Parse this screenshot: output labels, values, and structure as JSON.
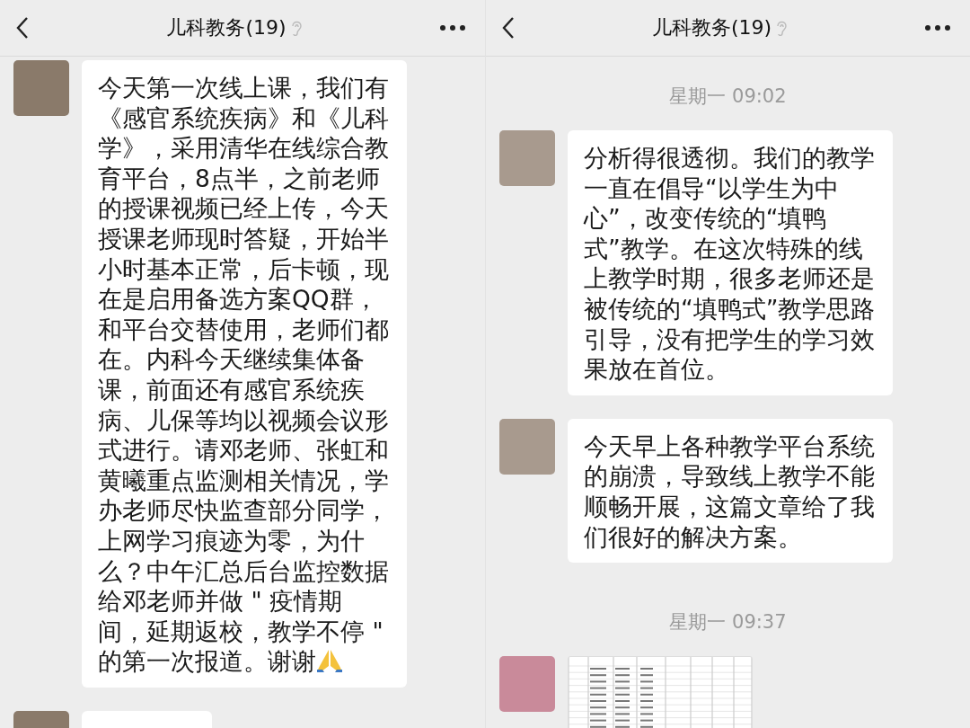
{
  "panels": [
    {
      "header": {
        "title": "儿科教务(19)"
      },
      "items": [
        {
          "kind": "message",
          "text": "今天第一次线上课，我们有《感官系统疾病》和《儿科学》，采用清华在线综合教育平台，8点半，之前老师的授课视频已经上传，今天授课老师现时答疑，开始半小时基本正常，后卡顿，现在是启用备选方案QQ群，和平台交替使用，老师们都在。内科今天继续集体备课，前面还有感官系统疾病、儿保等均以视频会议形式进行。请邓老师、张虹和黄曦重点监测相关情况，学办老师尽快监查部分同学，上网学习痕迹为零，为什么？中午汇总后台监控数据给邓老师并做 \" 疫情期间，延期返校，教学不停 \" 的第一次报道。谢谢",
          "emoji": true
        },
        {
          "kind": "partial"
        }
      ]
    },
    {
      "header": {
        "title": "儿科教务(19)"
      },
      "items": [
        {
          "kind": "time",
          "text": "星期一 09:02"
        },
        {
          "kind": "message",
          "text": "分析得很透彻。我们的教学一直在倡导“以学生为中心”，改变传统的“填鸭式”教学。在这次特殊的线上教学时期，很多老师还是被传统的“填鸭式”教学思路引导，没有把学生的学习效果放在首位。",
          "emoji": false
        },
        {
          "kind": "message",
          "text": "今天早上各种教学平台系统的崩溃，导致线上教学不能顺畅开展，这篇文章给了我们很好的解决方案。",
          "emoji": false
        },
        {
          "kind": "time",
          "text": "星期一 09:37"
        },
        {
          "kind": "image"
        }
      ]
    }
  ]
}
